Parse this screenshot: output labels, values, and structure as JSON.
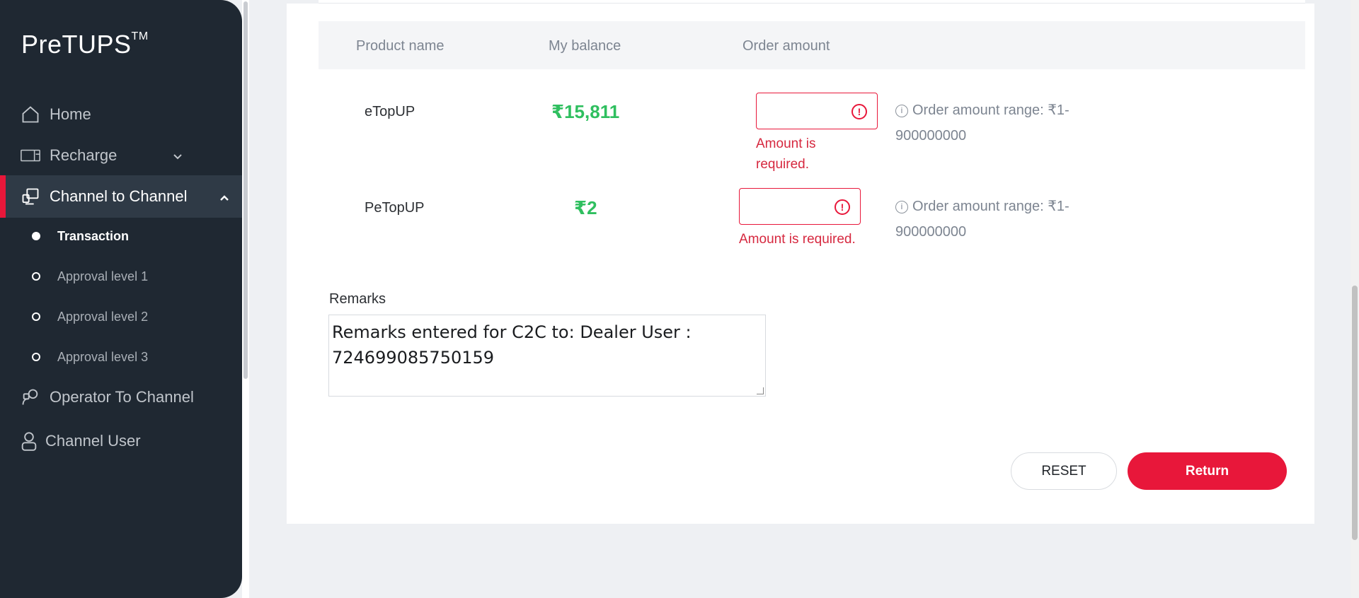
{
  "app": {
    "logo": "PreTUPS",
    "logo_tm": "TM"
  },
  "sidebar": {
    "items": [
      {
        "label": "Home",
        "icon": "home-icon"
      },
      {
        "label": "Recharge",
        "icon": "recharge-icon"
      },
      {
        "label": "Channel to Channel",
        "icon": "channel-icon"
      },
      {
        "label": "Operator To Channel",
        "icon": "operator-icon"
      },
      {
        "label": "Channel User",
        "icon": "user-icon"
      }
    ],
    "subitems": [
      {
        "label": "Transaction"
      },
      {
        "label": "Approval level 1"
      },
      {
        "label": "Approval level 2"
      },
      {
        "label": "Approval level 3"
      }
    ]
  },
  "table": {
    "headers": [
      "Product name",
      "My balance",
      "Order amount"
    ],
    "rows": [
      {
        "product": "eTopUP",
        "balance": "₹15,811",
        "amount": "",
        "error": "Amount is required.",
        "range": "Order amount range: ₹1-900000000"
      },
      {
        "product": "PeTopUP",
        "balance": "₹2",
        "amount": "",
        "error": "Amount is required.",
        "range": "Order amount range: ₹1-900000000"
      }
    ]
  },
  "remarks": {
    "label": "Remarks",
    "value": "Remarks entered for C2C to: Dealer User : 724699085750159"
  },
  "buttons": {
    "reset": "RESET",
    "return": "Return"
  },
  "colors": {
    "accent": "#e8173a",
    "sidebar": "#1f2832",
    "balance": "#2fbf5f",
    "error": "#d6283f"
  }
}
